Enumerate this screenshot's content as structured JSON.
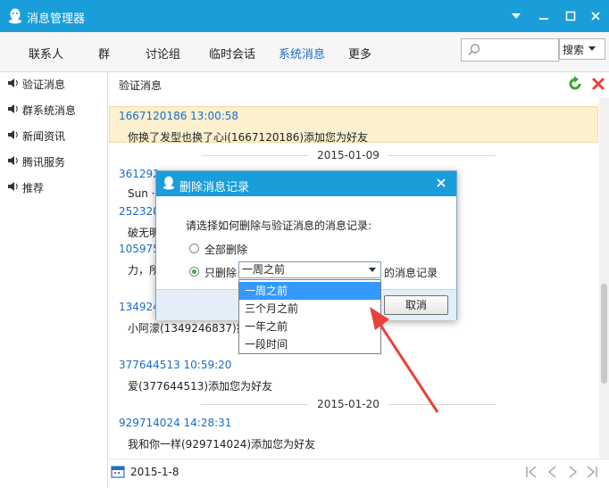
{
  "window": {
    "title": "消息管理器"
  },
  "tabs": [
    {
      "label": "联系人"
    },
    {
      "label": "群"
    },
    {
      "label": "讨论组"
    },
    {
      "label": "临时会话"
    },
    {
      "label": "系统消息"
    },
    {
      "label": "更多"
    }
  ],
  "search": {
    "button_label": "搜索",
    "placeholder": ""
  },
  "sidebar": {
    "items": [
      {
        "label": "验证消息"
      },
      {
        "label": "群系统消息"
      },
      {
        "label": "新闻资讯"
      },
      {
        "label": "腾讯服务"
      },
      {
        "label": "推荐"
      }
    ]
  },
  "main": {
    "header": "验证消息"
  },
  "messages": [
    {
      "head": "1667120186 13:00:58",
      "body": "你换了发型也换了心i(1667120186)添加您为好友"
    },
    {
      "head": "361292",
      "body": "Sun ·"
    },
    {
      "head": "252320",
      "body": "破无明"
    },
    {
      "head": "105975",
      "body": "力，所"
    },
    {
      "head": "134924",
      "body": "小阿濛(1349246837)接"
    },
    {
      "head": "377644513 10:59:20",
      "body": "爱(377644513)添加您为好友"
    },
    {
      "head": "929714024 14:28:31",
      "body": "我和你一样(929714024)添加您为好友"
    }
  ],
  "date_separators": [
    "2015-01-09",
    "2015-01-20"
  ],
  "footer": {
    "date": "2015-1-8"
  },
  "dialog": {
    "title": "删除消息记录",
    "prompt": "请选择如何删除与验证消息的消息记录:",
    "option_all": "全部删除",
    "option_only": "只删除",
    "selected_value": "一周之前",
    "suffix": "的消息记录",
    "cancel_label": "取消",
    "dropdown_options": [
      "一周之前",
      "三个月之前",
      "一年之前",
      "一段时间"
    ],
    "option_selected": "only"
  },
  "colors": {
    "accent": "#1a9ed9",
    "link": "#1a6dc4",
    "highlight": "#fcf0cf",
    "annotation": "#e8423c"
  }
}
